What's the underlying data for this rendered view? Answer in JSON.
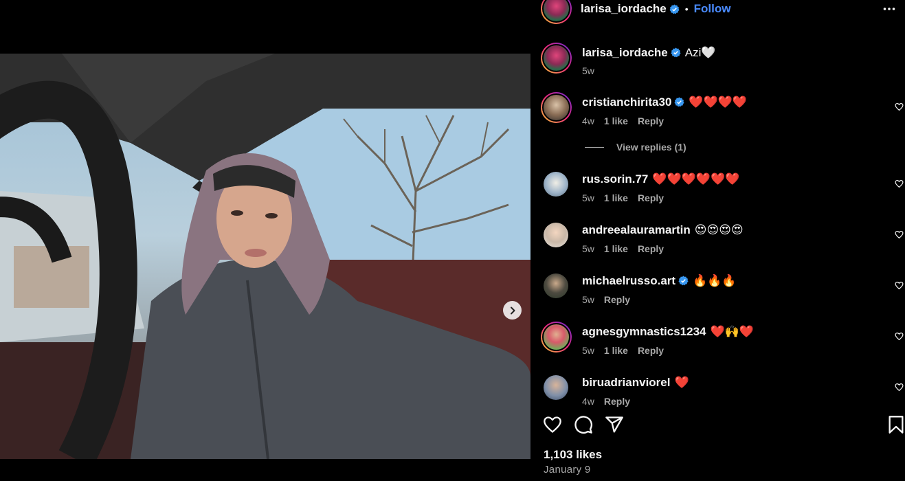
{
  "post": {
    "author": "larisa_iordache",
    "follow_label": "Follow",
    "separator": "•",
    "caption": "Azi🤍",
    "caption_age": "5w",
    "likes": "1,103 likes",
    "date": "January 9",
    "carousel": {
      "total": 2,
      "current": 1
    }
  },
  "comments": [
    {
      "user": "cristianchirita30",
      "verified": true,
      "text": "❤️❤️❤️❤️",
      "age": "4w",
      "likes": "1 like",
      "reply": "Reply"
    },
    {
      "user": "rus.sorin.77",
      "verified": false,
      "text": "❤️❤️❤️❤️❤️❤️",
      "age": "5w",
      "likes": "1 like",
      "reply": "Reply"
    },
    {
      "user": "andreealauramartin",
      "verified": false,
      "text": "😍😍😍😍",
      "age": "5w",
      "likes": "1 like",
      "reply": "Reply"
    },
    {
      "user": "michaelrusso.art",
      "verified": true,
      "text": "🔥🔥🔥",
      "age": "5w",
      "likes": "",
      "reply": "Reply"
    },
    {
      "user": "agnesgymnastics1234",
      "verified": false,
      "text": "❤️🙌❤️",
      "age": "5w",
      "likes": "1 like",
      "reply": "Reply"
    },
    {
      "user": "biruadrianviorel",
      "verified": false,
      "text": "❤️",
      "age": "4w",
      "likes": "",
      "reply": "Reply"
    }
  ],
  "view_replies": "View replies (1)",
  "icons": {
    "like": "heart-icon",
    "comment": "comment-icon",
    "share": "share-icon",
    "save": "bookmark-icon",
    "more": "more-icon",
    "next": "chevron-right-icon",
    "verified": "verified-badge-icon"
  },
  "colors": {
    "accent": "#4a8bff",
    "verified": "#3897f0",
    "muted": "#a8a8a8"
  }
}
